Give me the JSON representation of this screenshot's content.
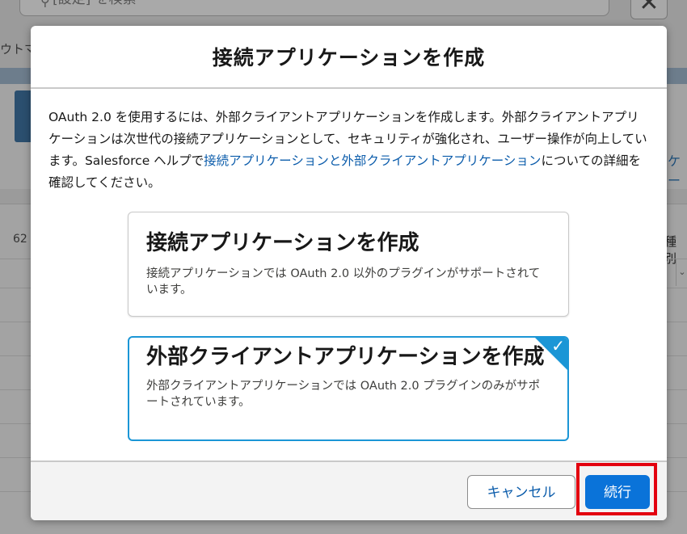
{
  "background": {
    "search_placeholder": "[設定] を検索",
    "close_glyph": "✕",
    "tab_fragment": "ウトマ",
    "card_link_fragment": "ケー",
    "list_count": "62",
    "column_fragment": "種別"
  },
  "modal": {
    "title": "接続アプリケーションを作成",
    "intro_text": "OAuth 2.0 を使用するには、外部クライアントアプリケーションを作成します。外部クライアントアプリケーションは次世代の接続アプリケーションとして、セキュリティが強化され、ユーザー操作が向上しています。Salesforce ヘルプで",
    "intro_link": "接続アプリケーションと外部クライアントアプリケーション",
    "intro_suffix": "についての詳細を確認してください。",
    "options": [
      {
        "title": "接続アプリケーションを作成",
        "description": "接続アプリケーションでは OAuth 2.0 以外のプラグインがサポートされています。",
        "selected": false
      },
      {
        "title": "外部クライアントアプリケーションを作成",
        "description": "外部クライアントアプリケーションでは OAuth 2.0 プラグインのみがサポートされています。",
        "selected": true
      }
    ],
    "cancel_label": "キャンセル",
    "continue_label": "続行"
  },
  "colors": {
    "accent": "#0a73d9",
    "link": "#0b5cab",
    "selected_border": "#1b96d6",
    "highlight": "#e3000f"
  },
  "icons": {
    "search": "search-icon",
    "close": "close-icon",
    "check": "checkmark-icon"
  }
}
